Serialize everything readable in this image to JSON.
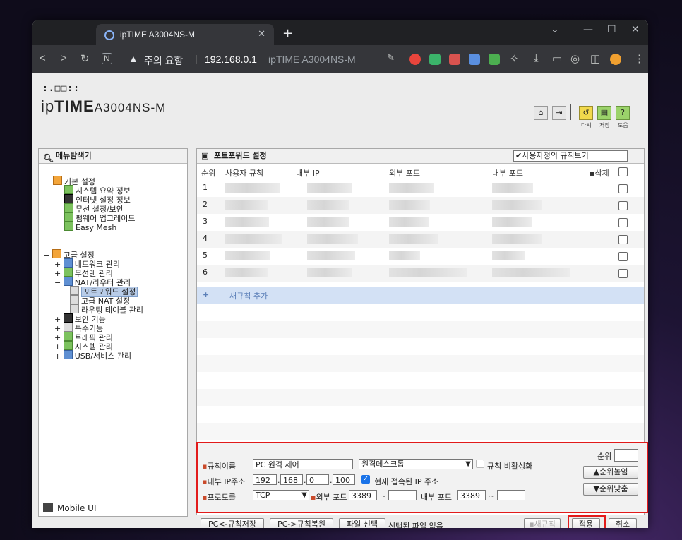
{
  "browser": {
    "tab_title": "ipTIME A3004NS-M",
    "new_tab": "+",
    "omnibox": {
      "warning": "주의 요함",
      "separator": "|",
      "host": "192.168.0.1",
      "page_title": "ipTIME A3004NS-M"
    }
  },
  "header": {
    "logo_top": ":.□□::",
    "logo_brand_a": "ip",
    "logo_brand_b": "TIME",
    "logo_model": "A3004NS-M",
    "icon_labels": {
      "restart": "다시",
      "save": "저장",
      "help": "도움"
    }
  },
  "menu": {
    "title": "메뉴탐색기",
    "items": [
      {
        "label": "기본 설정"
      },
      {
        "label": "시스템 요약 정보"
      },
      {
        "label": "인터넷 설정 정보"
      },
      {
        "label": "무선 설정/보안"
      },
      {
        "label": "펌웨어 업그레이드"
      },
      {
        "label": "Easy Mesh"
      },
      {
        "label": "고급 설정"
      },
      {
        "label": "네트워크 관리"
      },
      {
        "label": "무선랜 관리"
      },
      {
        "label": "NAT/라우터 관리"
      },
      {
        "label": "포트포워드 설정"
      },
      {
        "label": "고급 NAT 설정"
      },
      {
        "label": "라우팅 테이블 관리"
      },
      {
        "label": "보안 기능"
      },
      {
        "label": "특수기능"
      },
      {
        "label": "트래픽 관리"
      },
      {
        "label": "시스템 관리"
      },
      {
        "label": "USB/서비스 관리"
      }
    ],
    "mobile": "Mobile UI"
  },
  "portforward": {
    "title": "포트포워드 설정",
    "view_select": "사용자정의 규칙보기",
    "columns": {
      "order": "순위",
      "user_rule": "사용자 규칙",
      "internal_ip": "내부 IP",
      "external_port": "외부 포트",
      "internal_port": "내부 포트",
      "delete": "삭제"
    },
    "rows": [
      "1",
      "2",
      "3",
      "4",
      "5",
      "6"
    ],
    "add_rule": "새규칙 추가"
  },
  "form": {
    "rule_name_label": "규칙이름",
    "rule_name_value": "PC 원격 제어",
    "preset_value": "원격데스크톱",
    "disable_label": "규칙 비활성화",
    "internal_ip_label": "내부 IP주소",
    "ip": [
      "192",
      "168",
      "0",
      "100"
    ],
    "current_ip_label": "현재 접속된 IP 주소",
    "protocol_label": "프로토콜",
    "protocol_value": "TCP",
    "external_port_label": "외부 포트",
    "external_port_from": "3389",
    "internal_port_label": "내부 포트",
    "internal_port_from": "3389",
    "tilde": "~",
    "order_label": "순위",
    "order_up": "순위높임",
    "order_down": "순위낮춤"
  },
  "bottom": {
    "pc_save": "PC<-규칙저장",
    "pc_restore": "PC->규칙복원",
    "file_select": "파일 선택",
    "file_status": "선택된 파일 없음",
    "new_rule": "새규칙",
    "apply": "적용",
    "cancel": "취소"
  }
}
